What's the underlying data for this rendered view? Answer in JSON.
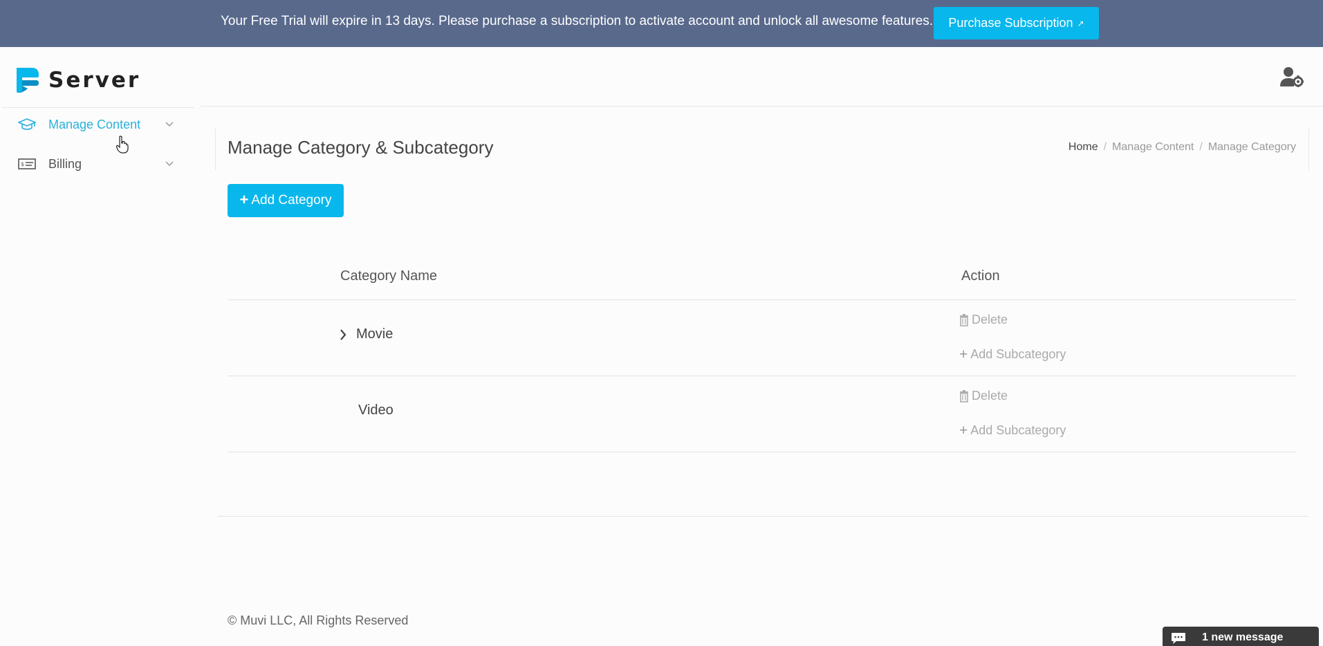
{
  "banner": {
    "message": "Your Free Trial will expire in 13 days. Please purchase a subscription to activate account and unlock all awesome features.",
    "purchase_label": "Purchase Subscription",
    "background": "#58698c",
    "button_color": "#08b7ec"
  },
  "header": {
    "brand": "Server",
    "user_icon": "user-gear-icon"
  },
  "sidebar": {
    "items": [
      {
        "label": "Manage Content",
        "icon": "graduation-cap-icon",
        "active": true,
        "color": "#2ab1dd"
      },
      {
        "label": "Billing",
        "icon": "billing-card-icon",
        "active": false
      }
    ]
  },
  "main": {
    "title": "Manage Category & Subcategory",
    "breadcrumb": {
      "home": "Home",
      "separator": "/",
      "level1": "Manage Content",
      "level2": "Manage Category"
    },
    "add_category_label": "Add Category"
  },
  "table": {
    "headers": {
      "name": "Category Name",
      "action": "Action"
    },
    "rows": [
      {
        "name": "Movie",
        "expandable": true,
        "delete_label": "Delete",
        "add_sub_label": "Add Subcategory"
      },
      {
        "name": "Video",
        "expandable": false,
        "delete_label": "Delete",
        "add_sub_label": "Add Subcategory"
      }
    ]
  },
  "footer": {
    "copyright": "© Muvi LLC, All Rights Reserved"
  },
  "chat": {
    "label": "1 new message",
    "icon": "chat-bubble-icon"
  }
}
